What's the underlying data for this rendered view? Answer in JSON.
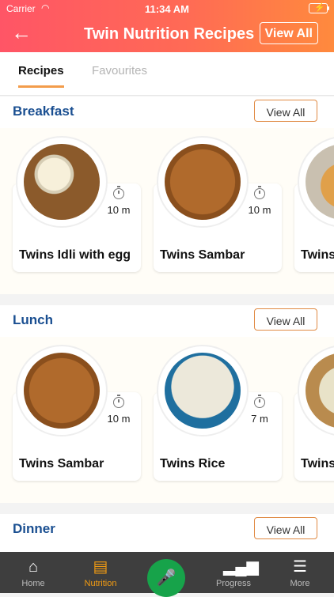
{
  "status": {
    "carrier": "Carrier",
    "time": "11:34 AM"
  },
  "header": {
    "title": "Twin Nutrition Recipes",
    "view_all": "View All",
    "back_icon": "back-arrow-icon"
  },
  "tabs": [
    {
      "label": "Recipes",
      "active": true
    },
    {
      "label": "Favourites",
      "active": false
    }
  ],
  "sections": [
    {
      "title": "Breakfast",
      "view_all": "View All",
      "cards": [
        {
          "name": "Twins Idli with egg",
          "time": "10 m"
        },
        {
          "name": "Twins Sambar",
          "time": "10 m"
        },
        {
          "name": "Twins",
          "time": ""
        }
      ]
    },
    {
      "title": "Lunch",
      "view_all": "View All",
      "cards": [
        {
          "name": "Twins Sambar",
          "time": "10 m"
        },
        {
          "name": "Twins Rice",
          "time": "7 m"
        },
        {
          "name": "Twins",
          "time": ""
        }
      ]
    },
    {
      "title": "Dinner",
      "view_all": "View All",
      "cards": []
    }
  ],
  "tabbar": [
    {
      "label": "Home",
      "icon": "home-icon",
      "active": false
    },
    {
      "label": "Nutrition",
      "icon": "nutrition-icon",
      "active": true
    },
    {
      "label": "",
      "icon": "mic-icon",
      "active": false
    },
    {
      "label": "Progress",
      "icon": "progress-icon",
      "active": false
    },
    {
      "label": "More",
      "icon": "menu-icon",
      "active": false
    }
  ],
  "colors": {
    "accent": "#f39c12",
    "header_start": "#ff5566",
    "header_end": "#ff8a3d",
    "section_title": "#1a4f91",
    "mic": "#17a34a"
  }
}
